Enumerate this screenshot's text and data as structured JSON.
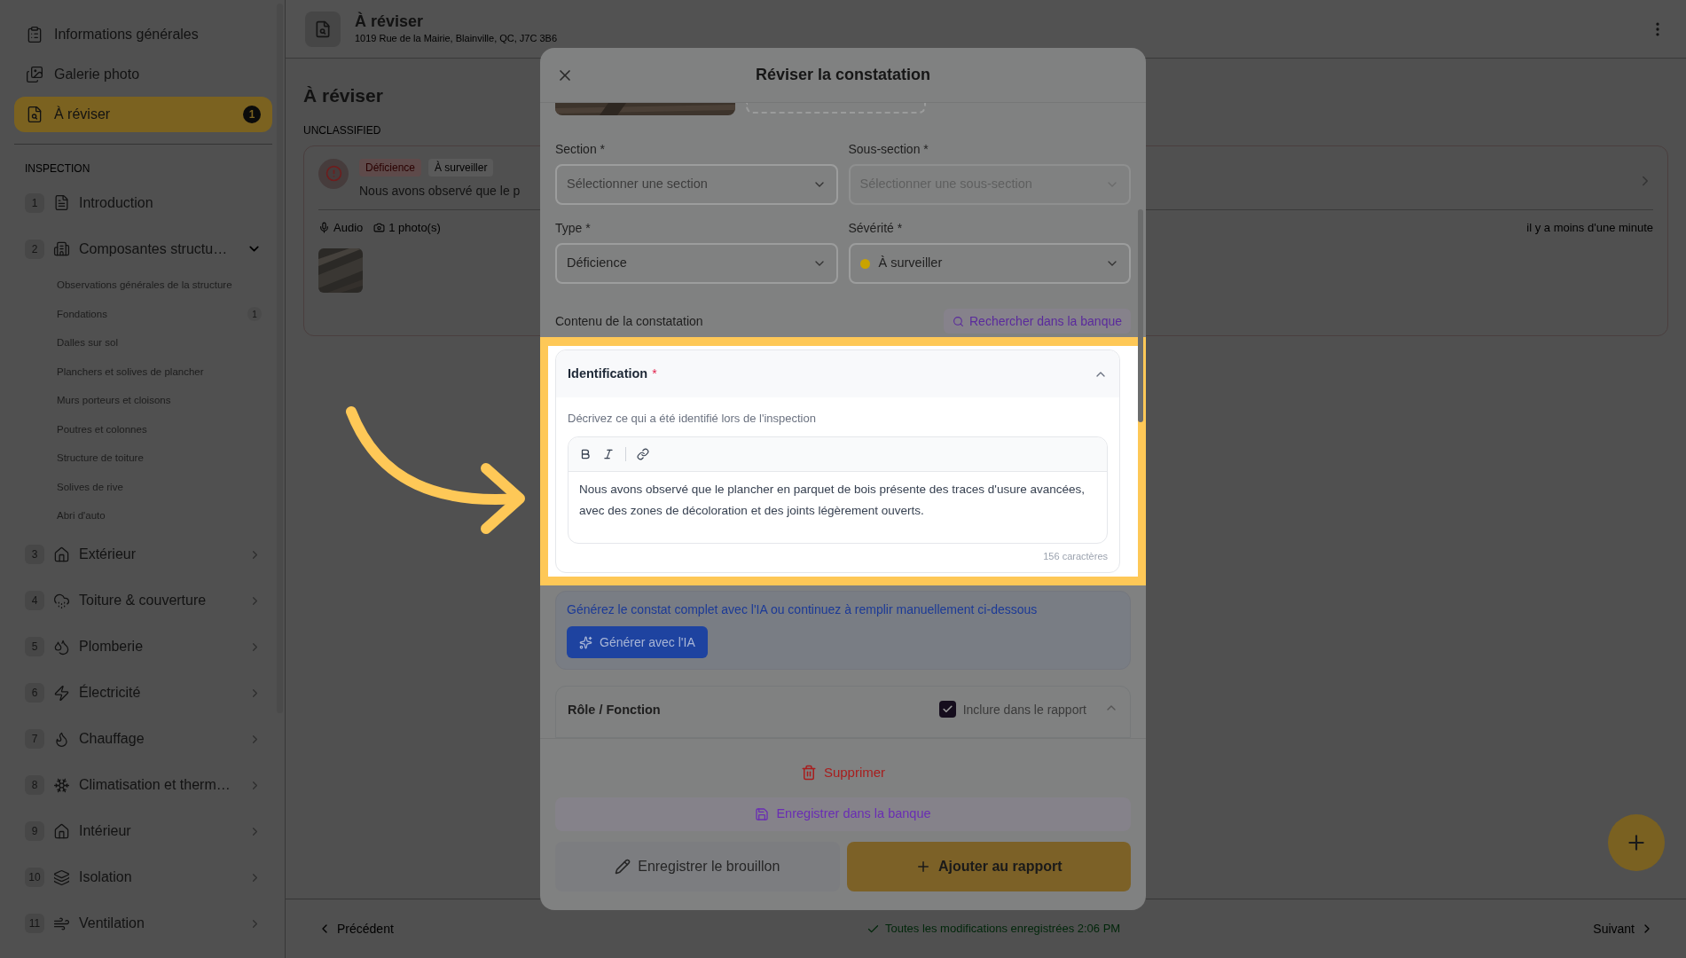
{
  "sidebar": {
    "top_items": [
      {
        "label": "Informations générales",
        "selected": false
      },
      {
        "label": "Galerie photo",
        "selected": false
      },
      {
        "label": "À réviser",
        "selected": true,
        "badge": "1"
      }
    ],
    "section_heading": "INSPECTION",
    "sections": [
      {
        "number": "1",
        "label": "Introduction"
      },
      {
        "number": "2",
        "label": "Composantes structu…",
        "expanded": true,
        "children": [
          {
            "label": "Observations générales de la structure"
          },
          {
            "label": "Fondations",
            "badge": "1"
          },
          {
            "label": "Dalles sur sol"
          },
          {
            "label": "Planchers et solives de plancher"
          },
          {
            "label": "Murs porteurs et cloisons"
          },
          {
            "label": "Poutres et colonnes"
          },
          {
            "label": "Structure de toiture"
          },
          {
            "label": "Solives de rive"
          },
          {
            "label": "Abri d'auto"
          }
        ]
      },
      {
        "number": "3",
        "label": "Extérieur",
        "expanded": false
      },
      {
        "number": "4",
        "label": "Toiture & couverture",
        "expanded": false
      },
      {
        "number": "5",
        "label": "Plomberie",
        "expanded": false
      },
      {
        "number": "6",
        "label": "Électricité",
        "expanded": false
      },
      {
        "number": "7",
        "label": "Chauffage",
        "expanded": false
      },
      {
        "number": "8",
        "label": "Climatisation et therm…",
        "expanded": false
      },
      {
        "number": "9",
        "label": "Intérieur",
        "expanded": false
      },
      {
        "number": "10",
        "label": "Isolation",
        "expanded": false
      },
      {
        "number": "11",
        "label": "Ventilation",
        "expanded": false
      }
    ]
  },
  "header": {
    "title": "À réviser",
    "subtitle": "1019 Rue de la Mairie, Blainville, QC, J7C 3B6"
  },
  "content": {
    "title": "À réviser",
    "group_label": "UNCLASSIFIED",
    "card": {
      "tags": [
        {
          "label": "Déficience",
          "kind": "danger"
        },
        {
          "label": "À surveiller",
          "kind": "neutral"
        }
      ],
      "text": "Nous avons observé que le p",
      "audio": "Audio",
      "photos": "1 photo(s)",
      "time": "il y a moins d'une minute"
    }
  },
  "modal": {
    "title": "Réviser la constatation",
    "fields": [
      {
        "label": "Section *",
        "placeholder": "Sélectionner une section",
        "disabled": false
      },
      {
        "label": "Sous-section *",
        "placeholder": "Sélectionner une sous-section",
        "disabled": true
      },
      {
        "label": "Type *",
        "value": "Déficience",
        "disabled": false
      },
      {
        "label": "Sévérité *",
        "value": "À surveiller",
        "disabled": false,
        "color": "#c9a300"
      }
    ],
    "content_label": "Contenu de la constatation",
    "search_button": "Rechercher dans la banque",
    "identification": {
      "title": "Identification",
      "required_mark": "*",
      "expanded": true,
      "hint": "Décrivez ce qui a été identifié lors de l'inspection",
      "text": "Nous avons observé que le plancher en parquet de bois présente des traces d'usure avancées, avec des zones de décoloration et des joints légèrement ouverts.",
      "count": "156 caractères"
    },
    "ai": {
      "text": "Générez le constat complet avec l'IA ou continuez à remplir manuellement ci-dessous",
      "button": "Générer avec l'IA"
    },
    "role": {
      "title": "Rôle / Fonction",
      "checkbox_label": "Inclure dans le rapport",
      "checked": true,
      "expanded": true
    },
    "delete_button": "Supprimer",
    "bank_button": "Enregistrer dans la banque",
    "draft_button": "Enregistrer le brouillon",
    "add_button": "Ajouter au rapport"
  },
  "bottom_bar": {
    "previous": "Précédent",
    "status": "Toutes les modifications enregistrées 2:06 PM",
    "next": "Suivant"
  }
}
